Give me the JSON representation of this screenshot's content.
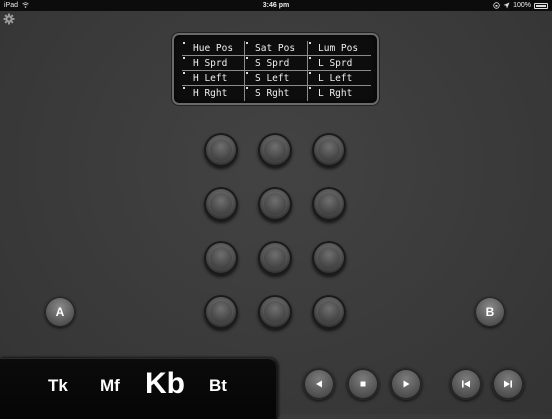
{
  "status": {
    "device": "iPad",
    "time": "3:46 pm",
    "battery": "100%"
  },
  "icons": {
    "settings": "gear-icon",
    "wifi": "wifi-icon",
    "location": "location-arrow-icon",
    "lock": "rotation-lock-icon",
    "battery": "battery-icon",
    "prev": "play-left-icon",
    "stop": "stop-icon",
    "play": "play-right-icon",
    "skip_back": "skip-back-icon",
    "skip_forward": "skip-forward-icon"
  },
  "lcd": {
    "rows": [
      [
        "Hue Pos",
        "Sat Pos",
        "Lum Pos"
      ],
      [
        "H Sprd",
        "S Sprd",
        "L Sprd"
      ],
      [
        "H Left",
        "S Left",
        "L Left"
      ],
      [
        "H Rght",
        "S Rght",
        "L Rght"
      ]
    ]
  },
  "buttons": {
    "a": "A",
    "b": "B"
  },
  "modes": {
    "tk": "Tk",
    "mf": "Mf",
    "kb": "Kb",
    "bt": "Bt",
    "selected": "Kb"
  }
}
